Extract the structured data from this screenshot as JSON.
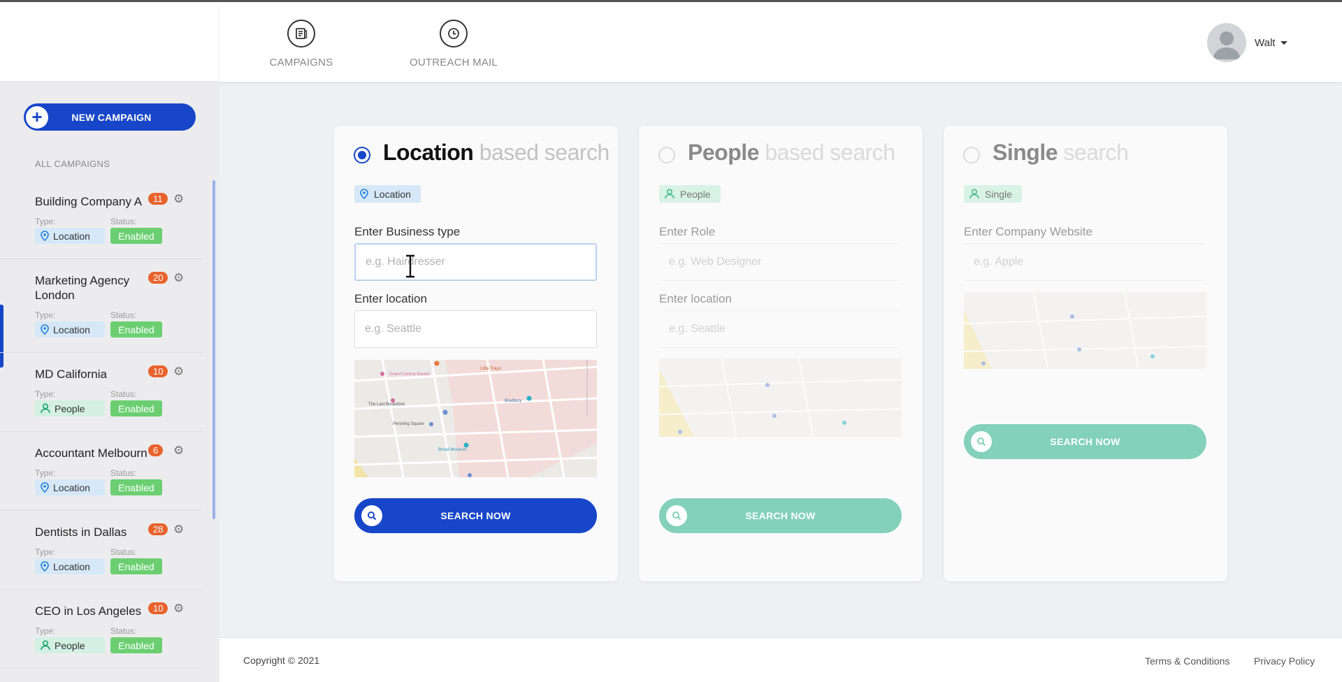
{
  "nav": {
    "items": [
      {
        "label": "CAMPAIGNS",
        "icon": "campaigns-icon"
      },
      {
        "label": "OUTREACH MAIL",
        "icon": "clock-icon"
      }
    ],
    "user_name": "Walt"
  },
  "sidebar": {
    "new_campaign_label": "NEW CAMPAIGN",
    "section_label": "ALL CAMPAIGNS",
    "type_label": "Type:",
    "status_label": "Status:",
    "campaigns": [
      {
        "name": "Building Company A",
        "count": "11",
        "type": "Location",
        "status": "Enabled"
      },
      {
        "name": "Marketing Agency London",
        "count": "20",
        "type": "Location",
        "status": "Enabled"
      },
      {
        "name": "MD California",
        "count": "10",
        "type": "People",
        "status": "Enabled"
      },
      {
        "name": "Accountant Melbourn",
        "count": "6",
        "type": "Location",
        "status": "Enabled"
      },
      {
        "name": "Dentists in Dallas",
        "count": "28",
        "type": "Location",
        "status": "Enabled"
      },
      {
        "name": "CEO in Los Angeles",
        "count": "10",
        "type": "People",
        "status": "Enabled"
      }
    ]
  },
  "cards": {
    "location": {
      "title_strong": "Location",
      "title_light": " based search",
      "chip": "Location",
      "field1_label": "Enter Business type",
      "field1_placeholder": "e.g. Hairdresser",
      "field2_label": "Enter location",
      "field2_placeholder": "e.g. Seattle",
      "button": "SEARCH NOW",
      "selected": true
    },
    "people": {
      "title_strong": "People",
      "title_light": " based search",
      "chip": "People",
      "field1_label": "Enter Role",
      "field1_placeholder": "e.g. Web Designer",
      "field2_label": "Enter location",
      "field2_placeholder": "e.g. Seattle",
      "button": "SEARCH NOW",
      "selected": false
    },
    "single": {
      "title_strong": "Single",
      "title_light": " search",
      "chip": "Single",
      "field1_label": "Enter Company Website",
      "field1_placeholder": "e.g. Apple",
      "button": "SEARCH NOW",
      "selected": false
    }
  },
  "map_labels": {
    "a": "Bradbury",
    "b": "Grand Central Market",
    "c": "Little Tokyo",
    "d": "Broad Museum",
    "e": "Pershing Square",
    "f": "The Last Bookstore"
  },
  "footer": {
    "copyright": "Copyright © 2021",
    "terms": "Terms & Conditions",
    "privacy": "Privacy Policy"
  },
  "colors": {
    "primary": "#1746c9",
    "accent_green": "#82d1b8",
    "status_green": "#6bcf72",
    "badge_orange": "#e8622c"
  }
}
